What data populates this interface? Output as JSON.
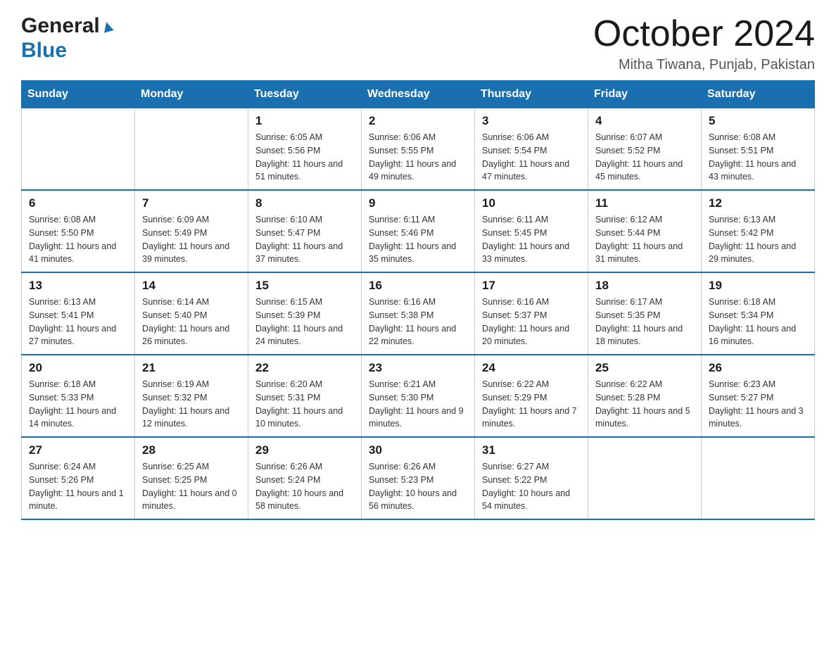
{
  "header": {
    "logo_general": "General",
    "logo_blue": "Blue",
    "month_year": "October 2024",
    "location": "Mitha Tiwana, Punjab, Pakistan"
  },
  "days_of_week": [
    "Sunday",
    "Monday",
    "Tuesday",
    "Wednesday",
    "Thursday",
    "Friday",
    "Saturday"
  ],
  "weeks": [
    [
      {
        "day": "",
        "info": ""
      },
      {
        "day": "",
        "info": ""
      },
      {
        "day": "1",
        "info": "Sunrise: 6:05 AM\nSunset: 5:56 PM\nDaylight: 11 hours\nand 51 minutes."
      },
      {
        "day": "2",
        "info": "Sunrise: 6:06 AM\nSunset: 5:55 PM\nDaylight: 11 hours\nand 49 minutes."
      },
      {
        "day": "3",
        "info": "Sunrise: 6:06 AM\nSunset: 5:54 PM\nDaylight: 11 hours\nand 47 minutes."
      },
      {
        "day": "4",
        "info": "Sunrise: 6:07 AM\nSunset: 5:52 PM\nDaylight: 11 hours\nand 45 minutes."
      },
      {
        "day": "5",
        "info": "Sunrise: 6:08 AM\nSunset: 5:51 PM\nDaylight: 11 hours\nand 43 minutes."
      }
    ],
    [
      {
        "day": "6",
        "info": "Sunrise: 6:08 AM\nSunset: 5:50 PM\nDaylight: 11 hours\nand 41 minutes."
      },
      {
        "day": "7",
        "info": "Sunrise: 6:09 AM\nSunset: 5:49 PM\nDaylight: 11 hours\nand 39 minutes."
      },
      {
        "day": "8",
        "info": "Sunrise: 6:10 AM\nSunset: 5:47 PM\nDaylight: 11 hours\nand 37 minutes."
      },
      {
        "day": "9",
        "info": "Sunrise: 6:11 AM\nSunset: 5:46 PM\nDaylight: 11 hours\nand 35 minutes."
      },
      {
        "day": "10",
        "info": "Sunrise: 6:11 AM\nSunset: 5:45 PM\nDaylight: 11 hours\nand 33 minutes."
      },
      {
        "day": "11",
        "info": "Sunrise: 6:12 AM\nSunset: 5:44 PM\nDaylight: 11 hours\nand 31 minutes."
      },
      {
        "day": "12",
        "info": "Sunrise: 6:13 AM\nSunset: 5:42 PM\nDaylight: 11 hours\nand 29 minutes."
      }
    ],
    [
      {
        "day": "13",
        "info": "Sunrise: 6:13 AM\nSunset: 5:41 PM\nDaylight: 11 hours\nand 27 minutes."
      },
      {
        "day": "14",
        "info": "Sunrise: 6:14 AM\nSunset: 5:40 PM\nDaylight: 11 hours\nand 26 minutes."
      },
      {
        "day": "15",
        "info": "Sunrise: 6:15 AM\nSunset: 5:39 PM\nDaylight: 11 hours\nand 24 minutes."
      },
      {
        "day": "16",
        "info": "Sunrise: 6:16 AM\nSunset: 5:38 PM\nDaylight: 11 hours\nand 22 minutes."
      },
      {
        "day": "17",
        "info": "Sunrise: 6:16 AM\nSunset: 5:37 PM\nDaylight: 11 hours\nand 20 minutes."
      },
      {
        "day": "18",
        "info": "Sunrise: 6:17 AM\nSunset: 5:35 PM\nDaylight: 11 hours\nand 18 minutes."
      },
      {
        "day": "19",
        "info": "Sunrise: 6:18 AM\nSunset: 5:34 PM\nDaylight: 11 hours\nand 16 minutes."
      }
    ],
    [
      {
        "day": "20",
        "info": "Sunrise: 6:18 AM\nSunset: 5:33 PM\nDaylight: 11 hours\nand 14 minutes."
      },
      {
        "day": "21",
        "info": "Sunrise: 6:19 AM\nSunset: 5:32 PM\nDaylight: 11 hours\nand 12 minutes."
      },
      {
        "day": "22",
        "info": "Sunrise: 6:20 AM\nSunset: 5:31 PM\nDaylight: 11 hours\nand 10 minutes."
      },
      {
        "day": "23",
        "info": "Sunrise: 6:21 AM\nSunset: 5:30 PM\nDaylight: 11 hours\nand 9 minutes."
      },
      {
        "day": "24",
        "info": "Sunrise: 6:22 AM\nSunset: 5:29 PM\nDaylight: 11 hours\nand 7 minutes."
      },
      {
        "day": "25",
        "info": "Sunrise: 6:22 AM\nSunset: 5:28 PM\nDaylight: 11 hours\nand 5 minutes."
      },
      {
        "day": "26",
        "info": "Sunrise: 6:23 AM\nSunset: 5:27 PM\nDaylight: 11 hours\nand 3 minutes."
      }
    ],
    [
      {
        "day": "27",
        "info": "Sunrise: 6:24 AM\nSunset: 5:26 PM\nDaylight: 11 hours\nand 1 minute."
      },
      {
        "day": "28",
        "info": "Sunrise: 6:25 AM\nSunset: 5:25 PM\nDaylight: 11 hours\nand 0 minutes."
      },
      {
        "day": "29",
        "info": "Sunrise: 6:26 AM\nSunset: 5:24 PM\nDaylight: 10 hours\nand 58 minutes."
      },
      {
        "day": "30",
        "info": "Sunrise: 6:26 AM\nSunset: 5:23 PM\nDaylight: 10 hours\nand 56 minutes."
      },
      {
        "day": "31",
        "info": "Sunrise: 6:27 AM\nSunset: 5:22 PM\nDaylight: 10 hours\nand 54 minutes."
      },
      {
        "day": "",
        "info": ""
      },
      {
        "day": "",
        "info": ""
      }
    ]
  ]
}
